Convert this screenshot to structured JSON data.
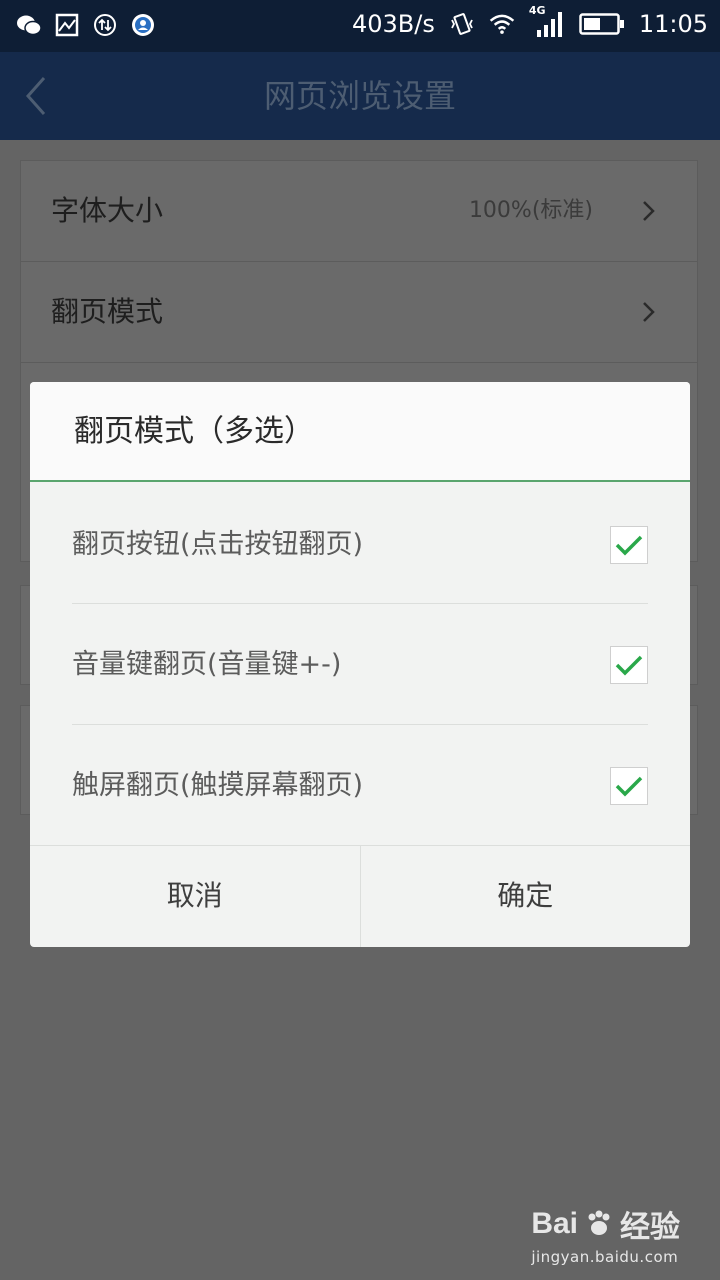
{
  "status_bar": {
    "net_speed": "403B/s",
    "network_type": "4G",
    "time": "11:05",
    "icons": [
      "wechat-icon",
      "image-icon",
      "sync-icon",
      "app-icon",
      "vibrate-icon",
      "wifi-icon",
      "signal-icon",
      "battery-icon"
    ]
  },
  "app_bar": {
    "title": "网页浏览设置"
  },
  "settings": {
    "font_size_label": "字体大小",
    "font_size_value": "100%(标准)",
    "page_turn_label": "翻页模式"
  },
  "dialog": {
    "title": "翻页模式（多选）",
    "options": [
      {
        "label": "翻页按钮(点击按钮翻页)",
        "checked": true
      },
      {
        "label": "音量键翻页(音量键+-)",
        "checked": true
      },
      {
        "label": "触屏翻页(触摸屏幕翻页)",
        "checked": true
      }
    ],
    "cancel": "取消",
    "confirm": "确定"
  },
  "watermark": {
    "brand": "Bai",
    "brand_suffix": "经验",
    "url": "jingyan.baidu.com"
  },
  "colors": {
    "check": "#2aa84a",
    "appbar": "#152a4b",
    "statusbar": "#0e1e35",
    "overlay": "#646464"
  }
}
